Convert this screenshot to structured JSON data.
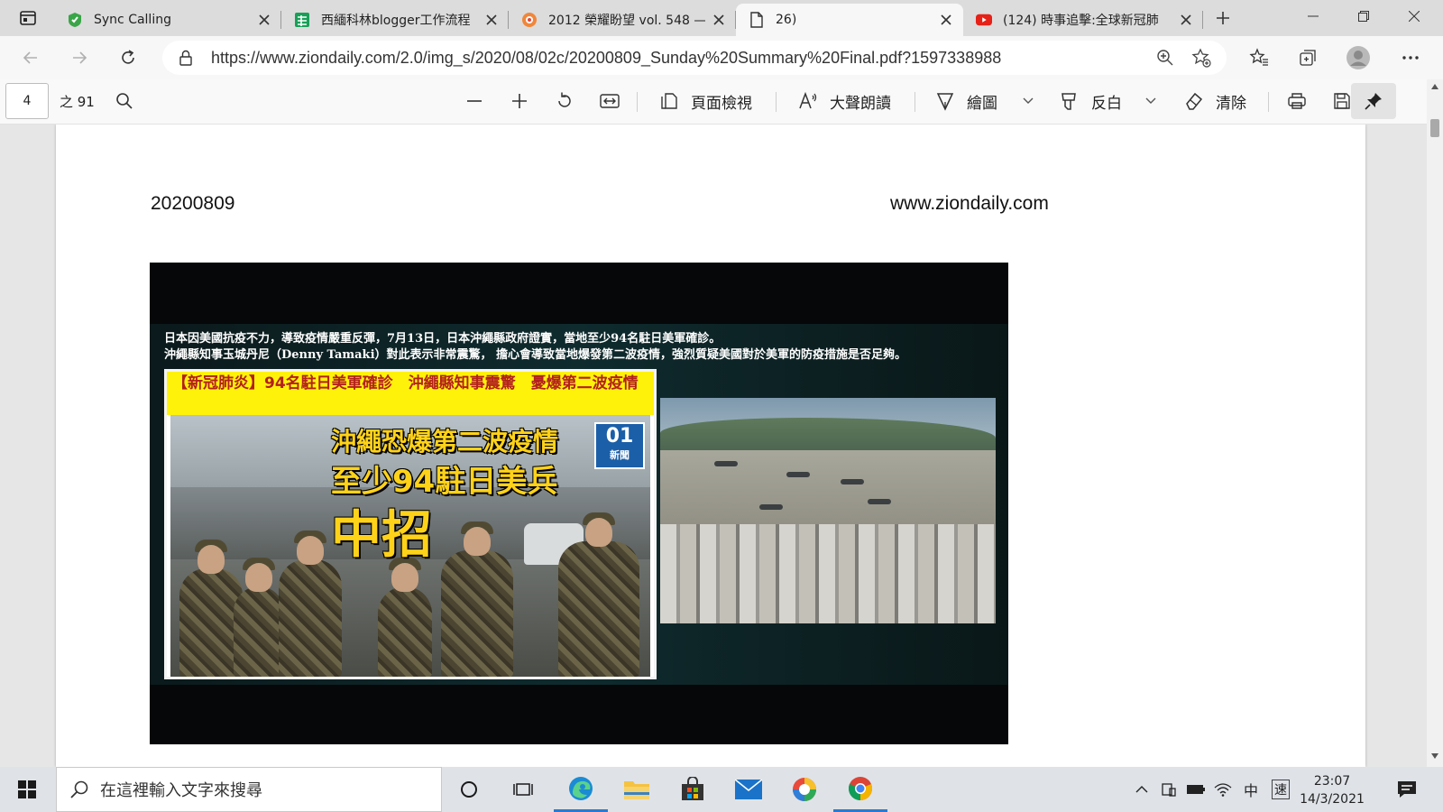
{
  "tabs": [
    {
      "title": "Sync Calling",
      "icon": "sync-calling-favicon"
    },
    {
      "title": "西緬科林blogger工作流程",
      "icon": "sheets-favicon"
    },
    {
      "title": "2012 榮耀盼望 vol. 548 —",
      "icon": "site-favicon"
    },
    {
      "title": "26)",
      "icon": "document-icon"
    },
    {
      "title": "(124) 時事追擊:全球新冠肺",
      "icon": "youtube-favicon"
    }
  ],
  "address_bar": {
    "url": "https://www.ziondaily.com/2.0/img_s/2020/08/02c/20200809_Sunday%20Summary%20Final.pdf?1597338988"
  },
  "pdf_toolbar": {
    "page_number": "4",
    "page_total": "之 91",
    "page_view": "頁面檢視",
    "read_aloud": "大聲朗讀",
    "draw": "繪圖",
    "highlight": "反白",
    "erase": "清除"
  },
  "document": {
    "header_date": "20200809",
    "header_site": "www.ziondaily.com",
    "image": {
      "caption_line1": "日本因美國抗疫不力，導致疫情嚴重反彈，7月13日，日本沖繩縣政府證實，當地至少94名駐日美軍確診。",
      "caption_line2": "沖繩縣知事玉城丹尼（Denny Tamaki）對此表示非常震驚， 擔心會導致當地爆發第二波疫情，強烈質疑美國對於美軍的防疫措施是否足夠。",
      "headline": "【新冠肺炎】94名駐日美軍確診　沖繩縣知事震驚　憂爆第二波疫情",
      "big_title_line1": "沖繩恐爆第二波疫情",
      "big_title_line2": "至少94駐日美兵",
      "big_title_line3": "中招",
      "badge_number": "01",
      "badge_text": "新聞"
    }
  },
  "taskbar": {
    "search_placeholder": "在這裡輸入文字來搜尋",
    "ime": "中",
    "ime_mode": "速",
    "time": "23:07",
    "date": "14/3/2021"
  },
  "colors": {
    "accent": "#2b7ad1",
    "headline_bg": "#fff20a",
    "headline_text": "#b3201e",
    "big_title": "#ffd21a",
    "badge": "#1b5fa8"
  }
}
